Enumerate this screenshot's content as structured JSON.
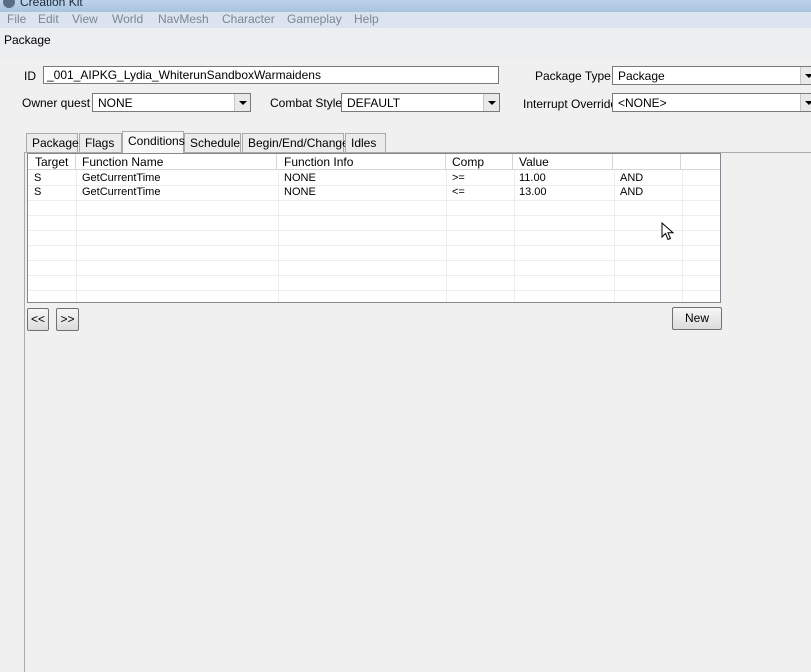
{
  "app": {
    "title": "Creation Kit",
    "menu": [
      "File",
      "Edit",
      "View",
      "World",
      "NavMesh",
      "Character",
      "Gameplay",
      "Help"
    ]
  },
  "dialog": {
    "title": "Package",
    "id_label": "ID",
    "id_value": "_001_AIPKG_Lydia_WhiterunSandboxWarmaidens",
    "package_type_label": "Package Type",
    "package_type_value": "Package",
    "owner_quest_label": "Owner quest",
    "owner_quest_value": "NONE",
    "combat_style_label": "Combat Style",
    "combat_style_value": "DEFAULT",
    "interrupt_override_label": "Interrupt Override",
    "interrupt_override_value": "<NONE>"
  },
  "tabs": [
    {
      "label": "Package"
    },
    {
      "label": "Flags"
    },
    {
      "label": "Conditions"
    },
    {
      "label": "Schedule"
    },
    {
      "label": "Begin/End/Change"
    },
    {
      "label": "Idles"
    }
  ],
  "active_tab": "Conditions",
  "conditions": {
    "columns": [
      "Target",
      "Function Name",
      "Function Info",
      "Comp",
      "Value",
      ""
    ],
    "rows": [
      [
        "S",
        "GetCurrentTime",
        "NONE",
        ">=",
        "11.00",
        "AND"
      ],
      [
        "S",
        "GetCurrentTime",
        "NONE",
        "<=",
        "13.00",
        "AND"
      ]
    ]
  },
  "buttons": {
    "prev": "<<",
    "next": ">>",
    "new": "New"
  },
  "icons": [
    "app-icon",
    "cursor-arrow-icon",
    "dropdown-arrow-icon"
  ]
}
